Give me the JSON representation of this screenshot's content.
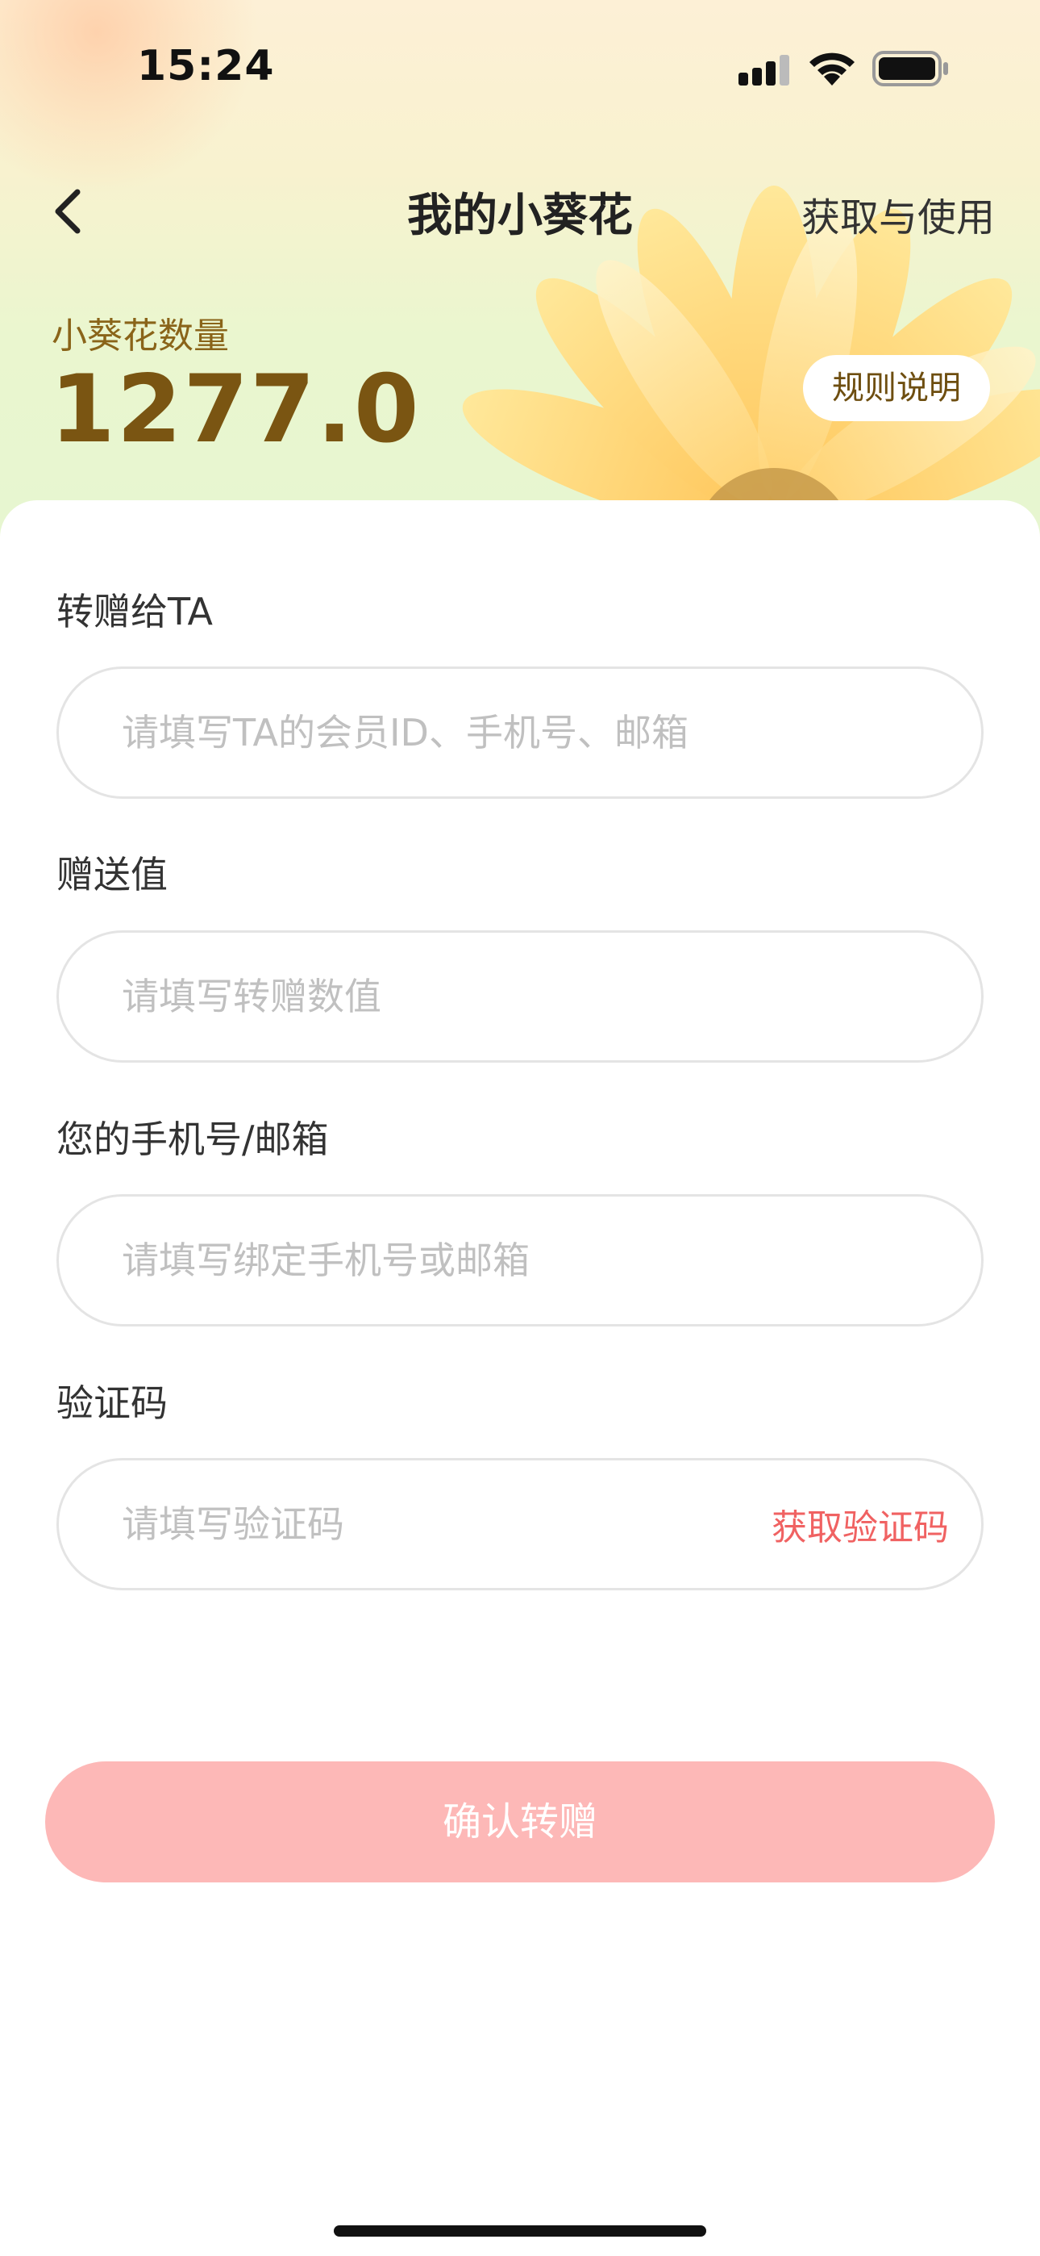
{
  "status_bar": {
    "time": "15:24",
    "icons": [
      "cellular-signal-icon",
      "wifi-icon",
      "battery-icon"
    ]
  },
  "nav": {
    "back_icon": "chevron-left-icon",
    "title": "我的小葵花",
    "right_action": "获取与使用"
  },
  "summary": {
    "label": "小葵花数量",
    "value": "1277.0",
    "rules_button": "规则说明",
    "decoration": "sunflower-illustration"
  },
  "form": {
    "recipient": {
      "label": "转赠给TA",
      "placeholder": "请填写TA的会员ID、手机号、邮箱",
      "value": ""
    },
    "amount": {
      "label": "赠送值",
      "placeholder": "请填写转赠数值",
      "value": ""
    },
    "contact": {
      "label": "您的手机号/邮箱",
      "placeholder": "请填写绑定手机号或邮箱",
      "value": ""
    },
    "code": {
      "label": "验证码",
      "placeholder": "请填写验证码",
      "value": "",
      "get_code": "获取验证码"
    },
    "submit": "确认转赠"
  },
  "colors": {
    "accent_red": "#f06262",
    "submit_disabled": "#fdb8b7",
    "brown_text": "#7a5512"
  }
}
